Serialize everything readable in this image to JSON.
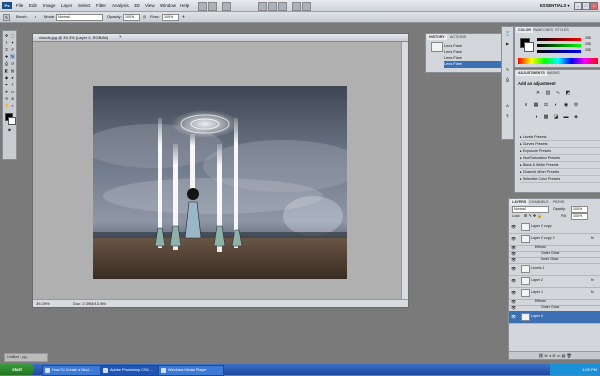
{
  "menubar": {
    "logo": "Ps",
    "items": [
      "File",
      "Edit",
      "Image",
      "Layer",
      "Select",
      "Filter",
      "Analysis",
      "3D",
      "View",
      "Window",
      "Help"
    ],
    "workspace": "ESSENTIALS ▾"
  },
  "options": {
    "brush_label": "Brush:",
    "mode_label": "Mode:",
    "mode_value": "Normal",
    "opacity_label": "Opacity:",
    "opacity_value": "100%",
    "flow_label": "Flow:",
    "flow_value": "100%"
  },
  "document": {
    "tab_title": "clouds.jpg @ 39.3% (Layer 0, RGB/8#)",
    "zoom": "39.29%",
    "status": "Doc: 2.39M/13.9M"
  },
  "history": {
    "tabs": [
      "HISTORY",
      "ACTIONS"
    ],
    "items": [
      "Lens Flare",
      "Lens Flare",
      "Lens Flare",
      "Lens Flare"
    ]
  },
  "color": {
    "tabs": [
      "COLOR",
      "SWATCHES",
      "STYLES"
    ],
    "values": [
      "255",
      "255",
      "255"
    ]
  },
  "adjustments": {
    "tabs": [
      "ADJUSTMENTS",
      "MASKS"
    ],
    "heading": "Add an adjustment",
    "presets": [
      "Levels Presets",
      "Curves Presets",
      "Exposure Presets",
      "Hue/Saturation Presets",
      "Black & White Presets",
      "Channel Mixer Presets",
      "Selective Color Presets"
    ]
  },
  "layers": {
    "tabs": [
      "LAYERS",
      "CHANNELS",
      "PATHS"
    ],
    "blend_mode": "Normal",
    "opacity_label": "Opacity:",
    "opacity_value": "100%",
    "lock_label": "Lock:",
    "fill_label": "Fill:",
    "fill_value": "100%",
    "rows": [
      {
        "name": "Layer 2 copy",
        "type": "layer",
        "fx": ""
      },
      {
        "name": "Layer 2 copy 2",
        "type": "layer",
        "fx": "fx"
      },
      {
        "name": "Effects",
        "type": "effect-head",
        "fx": ""
      },
      {
        "name": "Outer Glow",
        "type": "effect",
        "fx": ""
      },
      {
        "name": "Inner Glow",
        "type": "effect",
        "fx": ""
      },
      {
        "name": "Levels 1",
        "type": "layer",
        "fx": ""
      },
      {
        "name": "Layer 2",
        "type": "layer",
        "fx": "fx"
      },
      {
        "name": "Layer 1",
        "type": "layer",
        "fx": "fx"
      },
      {
        "name": "Effects",
        "type": "effect-head",
        "fx": ""
      },
      {
        "name": "Outer Glow",
        "type": "effect",
        "fx": ""
      },
      {
        "name": "Layer 0",
        "type": "layer",
        "fx": ""
      }
    ],
    "selected_index": 10
  },
  "taskbar": {
    "start": "start",
    "buttons": [
      "How To Create a Mod...",
      "Adobe Photoshop CS4 ...",
      "Windows Media Player"
    ],
    "clock": "1:05 PM"
  },
  "notice": "Untitled - pg..."
}
